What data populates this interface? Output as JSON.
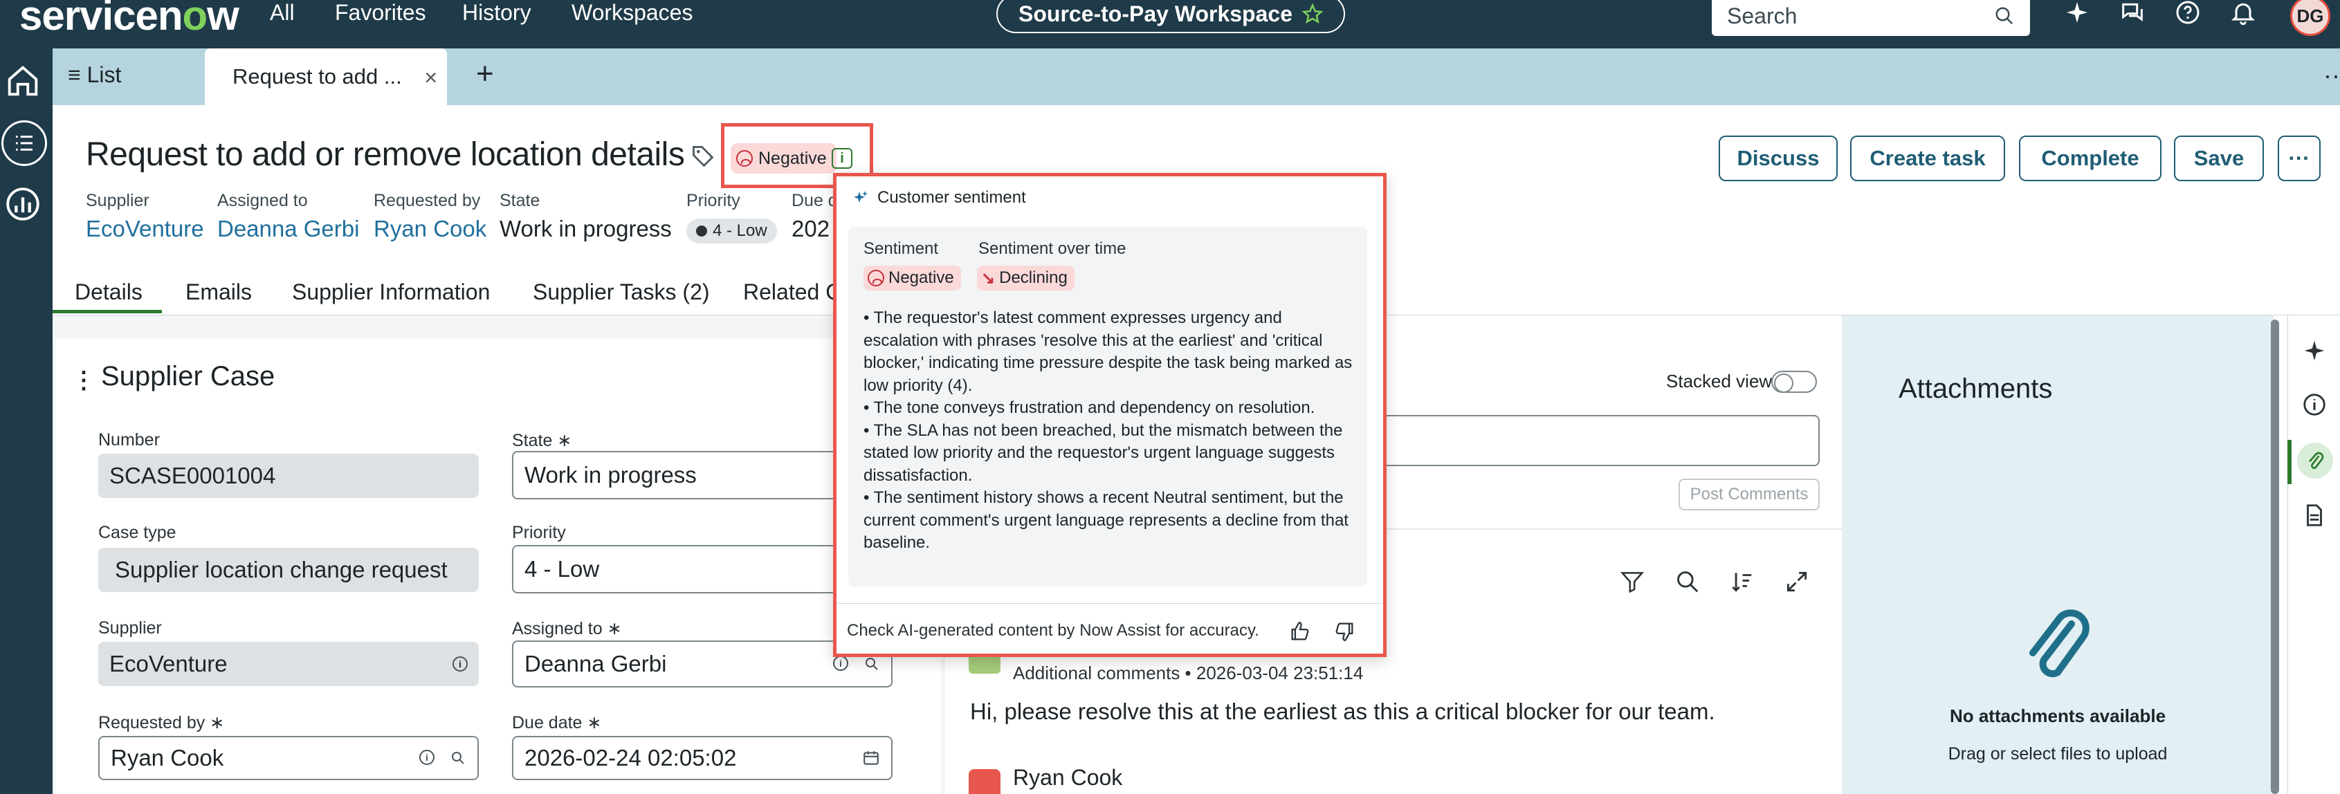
{
  "brand": {
    "pre": "servicen",
    "o": "o",
    "post": "w"
  },
  "nav": {
    "all": "All",
    "favorites": "Favorites",
    "history": "History",
    "workspaces": "Workspaces"
  },
  "workspace_pill": "Source-to-Pay Workspace",
  "search": {
    "label": "Search"
  },
  "user_initials": "DG",
  "tabs": {
    "list": "List",
    "active": "Request to add ...",
    "close": "×",
    "plus": "+"
  },
  "record": {
    "title": "Request to add or remove location details",
    "sentiment_badge": "Negative",
    "buttons": {
      "discuss": "Discuss",
      "create_task": "Create task",
      "complete": "Complete",
      "save": "Save",
      "more": "···"
    },
    "meta": [
      {
        "label": "Supplier",
        "value": "EcoVenture"
      },
      {
        "label": "Assigned to",
        "value": "Deanna Gerbi"
      },
      {
        "label": "Requested by",
        "value": "Ryan Cook"
      },
      {
        "label": "State",
        "value": "Work in progress"
      },
      {
        "label": "Priority",
        "value": "4 - Low"
      },
      {
        "label": "Due d",
        "value": "202"
      }
    ]
  },
  "detail_tabs": [
    "Details",
    "Emails",
    "Supplier Information",
    "Supplier Tasks (2)",
    "Related C"
  ],
  "form": {
    "title": "Supplier Case",
    "number": {
      "label": "Number",
      "value": "SCASE0001004"
    },
    "state": {
      "label": "State ∗",
      "value": "Work in progress"
    },
    "case_type": {
      "label": "Case type",
      "value": "Supplier location change request"
    },
    "priority": {
      "label": "Priority",
      "value": "4 - Low"
    },
    "supplier": {
      "label": "Supplier",
      "value": "EcoVenture"
    },
    "assigned_to": {
      "label": "Assigned to ∗",
      "value": "Deanna Gerbi"
    },
    "requested_by": {
      "label": "Requested by ∗",
      "value": "Ryan Cook"
    },
    "due_date": {
      "label": "Due date ∗",
      "value": "2026-02-24 02:05:02"
    }
  },
  "activity": {
    "stacked_view": "Stacked view",
    "post_comments": "Post Comments",
    "entry_meta": "Additional comments • 2026-03-04 23:51:14",
    "entry_text": "Hi, please resolve this at the earliest as this a critical blocker for our team.",
    "next_author": "Ryan Cook"
  },
  "attachments": {
    "title": "Attachments",
    "empty": "No attachments available",
    "hint": "Drag or select files to upload"
  },
  "sentiment_popover": {
    "title": "Customer sentiment",
    "col1_label": "Sentiment",
    "col2_label": "Sentiment over time",
    "sentiment": "Negative",
    "trend": "Declining",
    "bullets": [
      "• The requestor's latest comment expresses urgency and escalation with phrases 'resolve this at the earliest' and 'critical blocker,' indicating time pressure despite the task being marked as low priority (4).",
      "• The tone conveys frustration and dependency on resolution.",
      "• The SLA has not been breached, but the mismatch between the stated low priority and the requestor's urgent language suggests dissatisfaction.",
      "• The sentiment history shows a recent Neutral sentiment, but the current comment's urgent language represents a decline from that baseline."
    ],
    "footer": "Check AI-generated content by Now Assist for accuracy."
  },
  "colors": {
    "nav_bg": "#1f3a48",
    "tab_bar": "#b5d4dd",
    "accent_green": "#2d7a2d",
    "link_blue": "#1f6f9d",
    "negative_bg": "#fbd9d9",
    "highlight_red": "#e8574d"
  }
}
